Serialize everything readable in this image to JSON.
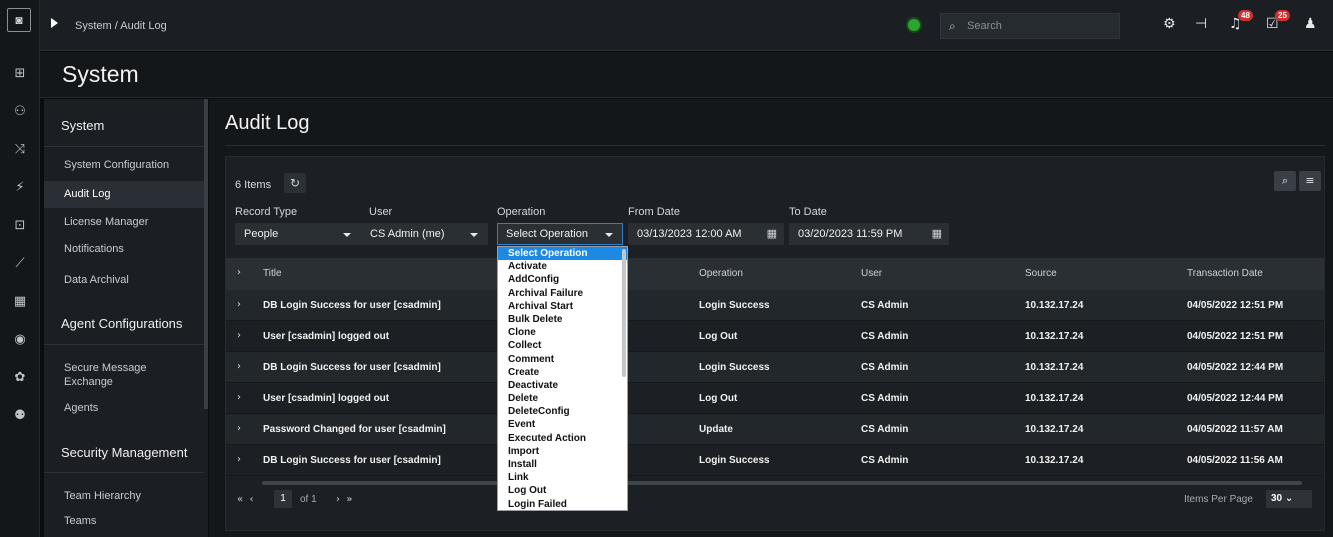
{
  "topbar": {
    "breadcrumb": "System / Audit Log",
    "search_placeholder": "Search",
    "bell_count": "48",
    "tasks_count": "25"
  },
  "header": {
    "title": "System"
  },
  "sidebar": {
    "sections": [
      {
        "title": "System",
        "items": [
          "System Configuration",
          "Audit Log",
          "License Manager",
          "Notifications",
          "Data Archival"
        ]
      },
      {
        "title": "Agent Configurations",
        "items": [
          "Secure Message Exchange",
          "Agents"
        ]
      },
      {
        "title": "Security Management",
        "items": [
          "Team Hierarchy",
          "Teams"
        ]
      }
    ],
    "active_item": "Audit Log"
  },
  "page": {
    "title": "Audit Log",
    "items_count": "6 Items"
  },
  "filters": {
    "record_type": {
      "label": "Record Type",
      "value": "People"
    },
    "user": {
      "label": "User",
      "value": "CS Admin (me)"
    },
    "operation": {
      "label": "Operation",
      "value": "Select Operation"
    },
    "from_date": {
      "label": "From Date",
      "value": "03/13/2023 12:00 AM"
    },
    "to_date": {
      "label": "To Date",
      "value": "03/20/2023 11:59 PM"
    }
  },
  "table": {
    "columns": [
      "Title",
      "Operation",
      "User",
      "Source",
      "Transaction Date"
    ],
    "rows": [
      [
        "DB Login Success for user [csadmin]",
        "Login Success",
        "CS Admin",
        "10.132.17.24",
        "04/05/2022 12:51 PM"
      ],
      [
        "User [csadmin] logged out",
        "Log Out",
        "CS Admin",
        "10.132.17.24",
        "04/05/2022 12:51 PM"
      ],
      [
        "DB Login Success for user [csadmin]",
        "Login Success",
        "CS Admin",
        "10.132.17.24",
        "04/05/2022 12:44 PM"
      ],
      [
        "User [csadmin] logged out",
        "Log Out",
        "CS Admin",
        "10.132.17.24",
        "04/05/2022 12:44 PM"
      ],
      [
        "Password Changed for user [csadmin]",
        "Update",
        "CS Admin",
        "10.132.17.24",
        "04/05/2022 11:57 AM"
      ],
      [
        "DB Login Success for user [csadmin]",
        "Login Success",
        "CS Admin",
        "10.132.17.24",
        "04/05/2022 11:56 AM"
      ]
    ]
  },
  "pagination": {
    "current": "1",
    "of": "of 1",
    "items_per_page_label": "Items Per Page",
    "items_per_page": "30"
  },
  "operation_dropdown": {
    "selected": "Select Operation",
    "options": [
      "Select Operation",
      "Activate",
      "AddConfig",
      "Archival Failure",
      "Archival Start",
      "Bulk Delete",
      "Clone",
      "Collect",
      "Comment",
      "Create",
      "Deactivate",
      "Delete",
      "DeleteConfig",
      "Event",
      "Executed Action",
      "Import",
      "Install",
      "Link",
      "Log Out",
      "Login Failed"
    ]
  }
}
